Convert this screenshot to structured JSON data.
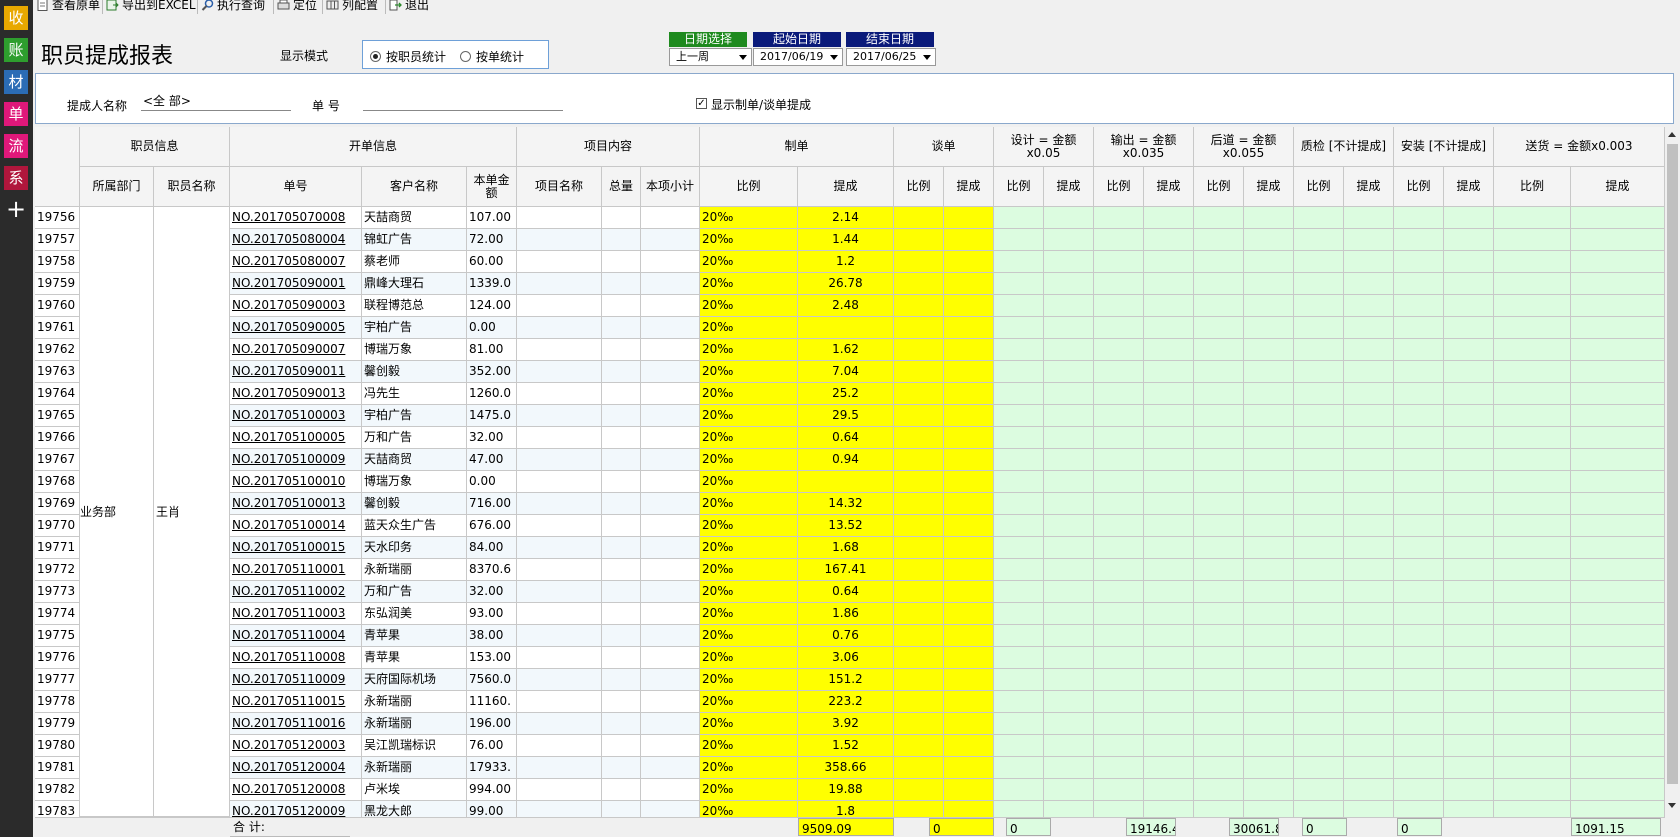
{
  "sidebar": {
    "items": [
      {
        "label": "收",
        "color": "#e8a800"
      },
      {
        "label": "账",
        "color": "#2e9e2e"
      },
      {
        "label": "材",
        "color": "#2b6cb5"
      },
      {
        "label": "单",
        "color": "#e0187a"
      },
      {
        "label": "流",
        "color": "#e0187a"
      },
      {
        "label": "系",
        "color": "#b0163c"
      }
    ],
    "add_label": "+"
  },
  "toolbar": {
    "view_original": "查看原单",
    "export_excel": "导出到EXCEL",
    "execute_query": "执行查询",
    "locate": "定位",
    "column_config": "列配置",
    "exit": "退出"
  },
  "header": {
    "title": "职员提成报表",
    "display_mode_label": "显示模式",
    "mode_by_employee": "按职员统计",
    "mode_by_order": "按单统计",
    "date_select_label": "日期选择",
    "start_date_label": "起始日期",
    "end_date_label": "结束日期",
    "date_select_value": "上一周",
    "start_date_value": "2017/06/19",
    "end_date_value": "2017/06/25"
  },
  "filter": {
    "commission_person_label": "提成人名称",
    "commission_person_value": "<全 部>",
    "order_no_label": "单  号",
    "order_no_value": "",
    "show_commission_label": "显示制单/谈单提成",
    "show_commission_checked": true
  },
  "columns": {
    "groups": {
      "employee_info": "职员信息",
      "order_info": "开单信息",
      "item_content": "项目内容",
      "make_order": "制单",
      "negotiate": "谈单",
      "design": "设计 = 金额\nx0.05",
      "output": "输出 = 金额\nx0.035",
      "post": "后道 = 金额\nx0.055",
      "qc": "质检 [不计提成]",
      "install": "安装 [不计提成]",
      "delivery": "送货 = 金额x0.003"
    },
    "sub": {
      "department": "所属部门",
      "employee_name": "职员名称",
      "order_no": "单号",
      "customer": "客户名称",
      "order_amount": "本单金\n额",
      "item_name": "项目名称",
      "quantity": "总量",
      "item_subtotal": "本项小计",
      "ratio": "比例",
      "commission": "提成"
    }
  },
  "group_cells": {
    "department": "业务部",
    "employee": "王肖"
  },
  "rows": [
    {
      "n": "19756",
      "order": "NO.201705070008",
      "customer": "天喆商贸",
      "amount": "107.00",
      "ratio": "20‰",
      "comm": "2.14"
    },
    {
      "n": "19757",
      "order": "NO.201705080004",
      "customer": "锦虹广告",
      "amount": "72.00",
      "ratio": "20‰",
      "comm": "1.44"
    },
    {
      "n": "19758",
      "order": "NO.201705080007",
      "customer": "蔡老师",
      "amount": "60.00",
      "ratio": "20‰",
      "comm": "1.2"
    },
    {
      "n": "19759",
      "order": "NO.201705090001",
      "customer": "鼎峰大理石",
      "amount": "1339.0",
      "ratio": "20‰",
      "comm": "26.78"
    },
    {
      "n": "19760",
      "order": "NO.201705090003",
      "customer": "联程博范总",
      "amount": "124.00",
      "ratio": "20‰",
      "comm": "2.48"
    },
    {
      "n": "19761",
      "order": "NO.201705090005",
      "customer": "宇柏广告",
      "amount": "0.00",
      "ratio": "20‰",
      "comm": ""
    },
    {
      "n": "19762",
      "order": "NO.201705090007",
      "customer": "博瑞万象",
      "amount": "81.00",
      "ratio": "20‰",
      "comm": "1.62"
    },
    {
      "n": "19763",
      "order": "NO.201705090011",
      "customer": "馨创毅",
      "amount": "352.00",
      "ratio": "20‰",
      "comm": "7.04"
    },
    {
      "n": "19764",
      "order": "NO.201705090013",
      "customer": "冯先生",
      "amount": "1260.0",
      "ratio": "20‰",
      "comm": "25.2"
    },
    {
      "n": "19765",
      "order": "NO.201705100003",
      "customer": "宇柏广告",
      "amount": "1475.0",
      "ratio": "20‰",
      "comm": "29.5"
    },
    {
      "n": "19766",
      "order": "NO.201705100005",
      "customer": "万和广告",
      "amount": "32.00",
      "ratio": "20‰",
      "comm": "0.64"
    },
    {
      "n": "19767",
      "order": "NO.201705100009",
      "customer": "天喆商贸",
      "amount": "47.00",
      "ratio": "20‰",
      "comm": "0.94"
    },
    {
      "n": "19768",
      "order": "NO.201705100010",
      "customer": "博瑞万象",
      "amount": "0.00",
      "ratio": "20‰",
      "comm": ""
    },
    {
      "n": "19769",
      "order": "NO.201705100013",
      "customer": "馨创毅",
      "amount": "716.00",
      "ratio": "20‰",
      "comm": "14.32"
    },
    {
      "n": "19770",
      "order": "NO.201705100014",
      "customer": "蓝天众生广告",
      "amount": "676.00",
      "ratio": "20‰",
      "comm": "13.52"
    },
    {
      "n": "19771",
      "order": "NO.201705100015",
      "customer": "天水印务",
      "amount": "84.00",
      "ratio": "20‰",
      "comm": "1.68"
    },
    {
      "n": "19772",
      "order": "NO.201705110001",
      "customer": "永新瑞丽",
      "amount": "8370.6",
      "ratio": "20‰",
      "comm": "167.41"
    },
    {
      "n": "19773",
      "order": "NO.201705110002",
      "customer": "万和广告",
      "amount": "32.00",
      "ratio": "20‰",
      "comm": "0.64"
    },
    {
      "n": "19774",
      "order": "NO.201705110003",
      "customer": "东弘润美",
      "amount": "93.00",
      "ratio": "20‰",
      "comm": "1.86"
    },
    {
      "n": "19775",
      "order": "NO.201705110004",
      "customer": "青苹果",
      "amount": "38.00",
      "ratio": "20‰",
      "comm": "0.76"
    },
    {
      "n": "19776",
      "order": "NO.201705110008",
      "customer": "青苹果",
      "amount": "153.00",
      "ratio": "20‰",
      "comm": "3.06"
    },
    {
      "n": "19777",
      "order": "NO.201705110009",
      "customer": "天府国际机场",
      "amount": "7560.0",
      "ratio": "20‰",
      "comm": "151.2"
    },
    {
      "n": "19778",
      "order": "NO.201705110015",
      "customer": "永新瑞丽",
      "amount": "11160.",
      "ratio": "20‰",
      "comm": "223.2"
    },
    {
      "n": "19779",
      "order": "NO.201705110016",
      "customer": "永新瑞丽",
      "amount": "196.00",
      "ratio": "20‰",
      "comm": "3.92"
    },
    {
      "n": "19780",
      "order": "NO.201705120003",
      "customer": "吴江凯瑞标识",
      "amount": "76.00",
      "ratio": "20‰",
      "comm": "1.52"
    },
    {
      "n": "19781",
      "order": "NO.201705120004",
      "customer": "永新瑞丽",
      "amount": "17933.",
      "ratio": "20‰",
      "comm": "358.66"
    },
    {
      "n": "19782",
      "order": "NO.201705120008",
      "customer": "卢米埃",
      "amount": "994.00",
      "ratio": "20‰",
      "comm": "19.88"
    },
    {
      "n": "19783",
      "order": "NO.201705120009",
      "customer": "黑龙大郎",
      "amount": "99.00",
      "ratio": "20‰",
      "comm": "1.8"
    }
  ],
  "totals": {
    "label": "合  计:",
    "make_commission": "9509.09",
    "negotiate_commission": "0",
    "design_commission": "0",
    "output_commission": "19146.4",
    "post_commission": "30061.8",
    "qc_commission": "0",
    "install_commission": "0",
    "delivery_commission": "1091.15"
  },
  "colors": {
    "yellow": "#ffff00",
    "green_cell": "#dcfce0",
    "date_select_header": "#1e8a1e",
    "date_header": "#0a1a7a"
  },
  "icons": [
    "document-icon",
    "excel-export-icon",
    "search-query-icon",
    "locate-icon",
    "column-config-icon",
    "exit-icon",
    "radio-icon",
    "checkbox-icon",
    "dropdown-arrow-icon",
    "plus-icon",
    "scroll-up-icon",
    "scroll-down-icon"
  ]
}
